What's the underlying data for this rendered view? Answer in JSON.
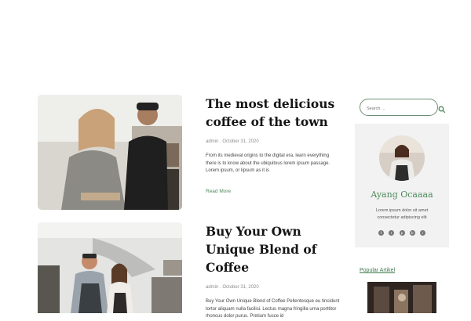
{
  "posts": [
    {
      "title": "The most delicious coffee of the town",
      "meta": "admin . October 31, 2020",
      "excerpt": "From its medieval origins to the digital era, learn everything there is to know about the ubiquitous lorem ipsum passage. Lorem ipsum, or lipsum as it is",
      "read_more": "Read More"
    },
    {
      "title": "Buy Your Own Unique Blend of Coffee",
      "meta": "admin . October 31, 2020",
      "excerpt": "Buy Your Own Unique Blend of Coffee Pellentesque eu tincidunt tortor aliquam nulla facilisi. Lectus magna fringilla urna porttitor rhoncus dolor purus. Pretium fusce id"
    }
  ],
  "sidebar": {
    "search_placeholder": "Search ...",
    "profile": {
      "name": "Ayang Ocaaaa",
      "bio": "Lorem ipsum dolor sit amet consectetur adipiscing elit"
    },
    "socials": [
      "facebook-icon",
      "twitter-icon",
      "pinterest-icon",
      "behance-icon",
      "instagram-icon"
    ],
    "popular_title": "Popular Artikel"
  },
  "colors": {
    "accent": "#4d8a5b",
    "card_bg": "#f2f2f2"
  }
}
